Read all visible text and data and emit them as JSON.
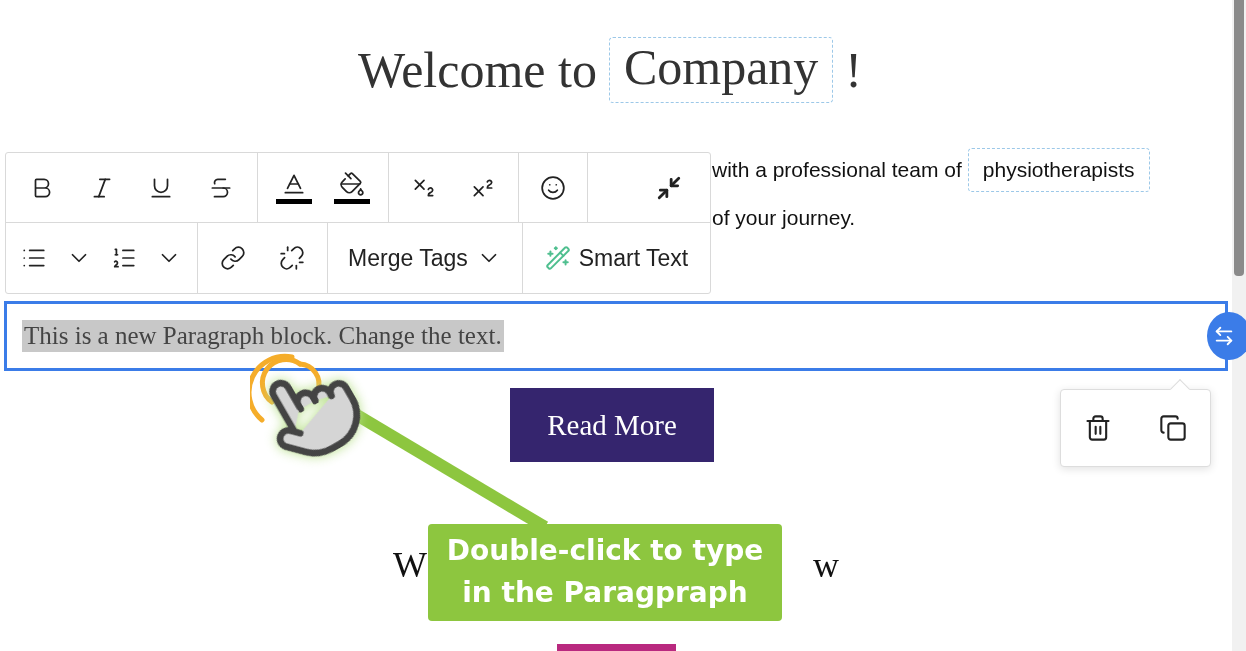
{
  "title": {
    "text": "Welcome to",
    "tag": "Company",
    "suffix": "!"
  },
  "intro": {
    "line_1": "with a professional team of",
    "tag": "physiotherapists",
    "line_2": "of your journey."
  },
  "toolbar": {
    "merge_tags": "Merge Tags",
    "smart_text": "Smart Text"
  },
  "selected_block": {
    "text": "This is a new Paragraph block. Change the text.",
    "selected": true
  },
  "read_more_button": "Read More",
  "heading_fragments": [
    "W",
    "w"
  ],
  "callout": {
    "text": "Double-click to type in the Paragpraph"
  }
}
